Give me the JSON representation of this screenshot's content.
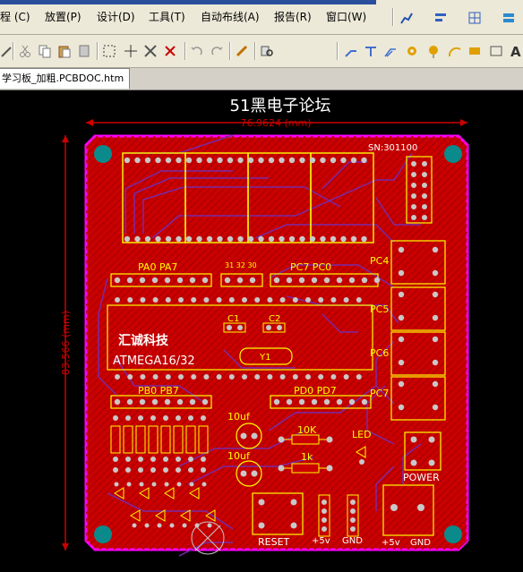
{
  "menu": [
    {
      "id": "project",
      "label": "程 (C)"
    },
    {
      "id": "place",
      "label": "放置(P)"
    },
    {
      "id": "design",
      "label": "设计(D)"
    },
    {
      "id": "tools",
      "label": "工具(T)"
    },
    {
      "id": "autoroute",
      "label": "自动布线(A)"
    },
    {
      "id": "report",
      "label": "报告(R)"
    },
    {
      "id": "window",
      "label": "窗口(W)"
    }
  ],
  "document_tab": "学习板_加粗.PCBDOC.htm",
  "board": {
    "watermark": "51黑电子论坛",
    "width_dim": "76.9624 (mm)",
    "height_dim": "83.566 (mm)",
    "serial": "SN:301100",
    "port_labels": {
      "pa": "PA0  PA7",
      "pc": "PC7  PC0",
      "pb": "PB0  PB7",
      "pd": "PD0  PD7",
      "pins_313233": "31 32 30"
    },
    "side_labels": [
      "PC4",
      "PC5",
      "PC6",
      "PC7"
    ],
    "mcu_company": "汇诚科技",
    "mcu_model": "ATMEGA16/32",
    "c1": "C1",
    "c2": "C2",
    "y1": "Y1",
    "cap_a": "10uf",
    "cap_b": "10uf",
    "res_10k": "10K",
    "res_1k": "1k",
    "led": "LED",
    "power": "POWER",
    "reset": "RESET",
    "vcc1": "+5v",
    "gnd1": "GND",
    "vcc2": "+5v",
    "gnd2": "GND"
  },
  "colors": {
    "board_red": "#cc0000",
    "trace_purple": "#7a2aa8",
    "outline_magenta": "#ff00ff",
    "silk_yellow": "#ffff00",
    "pad_teal": "#0a8a8a"
  }
}
